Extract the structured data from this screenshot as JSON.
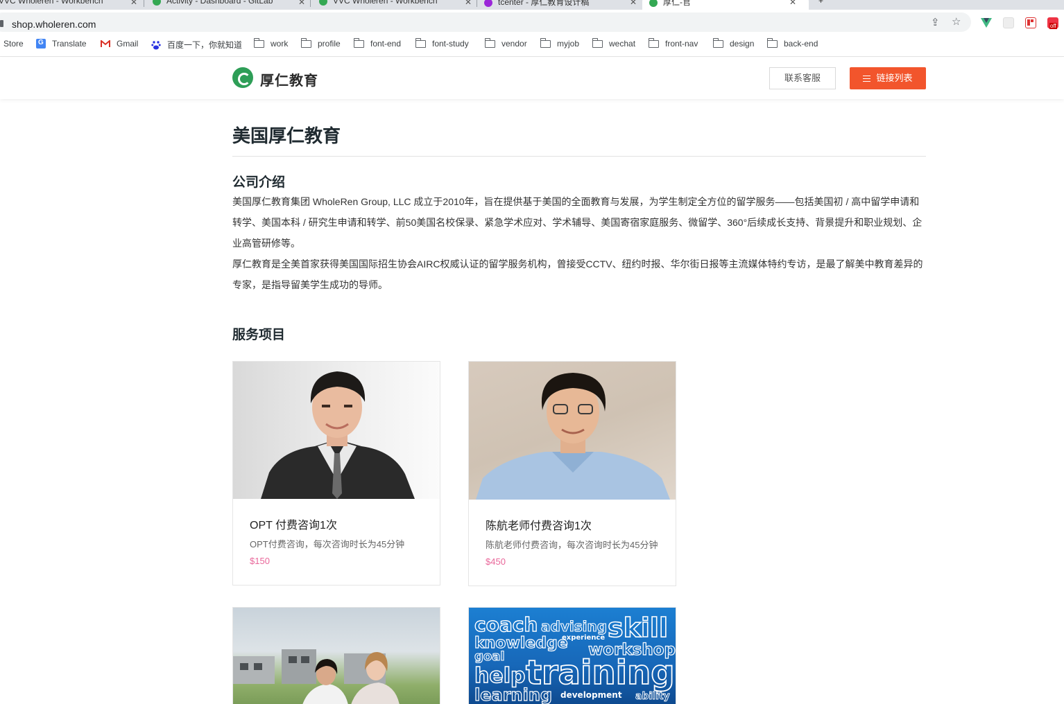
{
  "browser": {
    "tabs": [
      {
        "label": "VVC Wholeren - Workbench"
      },
      {
        "label": "Activity - Dashboard - GitLab"
      },
      {
        "label": "VVC Wholeren - Workbench"
      },
      {
        "label": "tcenter - 厚仁教育设计稿"
      },
      {
        "label": "厚仁-官"
      }
    ],
    "url": "shop.wholeren.com",
    "bookmarks": [
      {
        "label": "Store",
        "icon": "store-icon"
      },
      {
        "label": "Translate",
        "icon": "translate-icon"
      },
      {
        "label": "Gmail",
        "icon": "gmail-icon"
      },
      {
        "label": "百度一下，你就知道",
        "icon": "baidu-icon"
      },
      {
        "label": "work",
        "icon": "folder-icon"
      },
      {
        "label": "profile",
        "icon": "folder-icon"
      },
      {
        "label": "font-end",
        "icon": "folder-icon"
      },
      {
        "label": "font-study",
        "icon": "folder-icon"
      },
      {
        "label": "vendor",
        "icon": "folder-icon"
      },
      {
        "label": "myjob",
        "icon": "folder-icon"
      },
      {
        "label": "wechat",
        "icon": "folder-icon"
      },
      {
        "label": "front-nav",
        "icon": "folder-icon"
      },
      {
        "label": "design",
        "icon": "folder-icon"
      },
      {
        "label": "back-end",
        "icon": "folder-icon"
      }
    ],
    "extension_badge": "off"
  },
  "header": {
    "logo_text": "厚仁教育",
    "contact_label": "联系客服",
    "links_label": "链接列表",
    "accent_color": "#f2552c",
    "brand_color": "#2e9e57"
  },
  "main": {
    "title": "美国厚仁教育",
    "intro_heading": "公司介绍",
    "intro_paragraphs": [
      "美国厚仁教育集团 WholeRen Group, LLC 成立于2010年，旨在提供基于美国的全面教育与发展，为学生制定全方位的留学服务——包括美国初 / 高中留学申请和转学、美国本科 / 研究生申请和转学、前50美国名校保录、紧急学术应对、学术辅导、美国寄宿家庭服务、微留学、360°后续成长支持、背景提升和职业规划、企业高管研修等。",
      "厚仁教育是全美首家获得美国国际招生协会AIRC权威认证的留学服务机构，曾接受CCTV、纽约时报、华尔街日报等主流媒体特约专访，是最了解美中教育差异的专家，是指导留美学生成功的导师。"
    ],
    "services_heading": "服务项目",
    "services": [
      {
        "name": "OPT 付费咨询1次",
        "desc": "OPT付费咨询，每次咨询时长为45分钟",
        "price": "$150"
      },
      {
        "name": "陈航老师付费咨询1次",
        "desc": "陈航老师付费咨询，每次咨询时长为45分钟",
        "price": "$450"
      },
      {
        "name": "",
        "desc": "",
        "price": ""
      },
      {
        "name": "",
        "desc": "",
        "price": ""
      }
    ],
    "word_cloud": [
      "coach",
      "advising",
      "skill",
      "knowledge",
      "experience",
      "workshop",
      "goal",
      "help",
      "training",
      "learning",
      "development",
      "ability"
    ],
    "price_color": "#e9679a"
  }
}
